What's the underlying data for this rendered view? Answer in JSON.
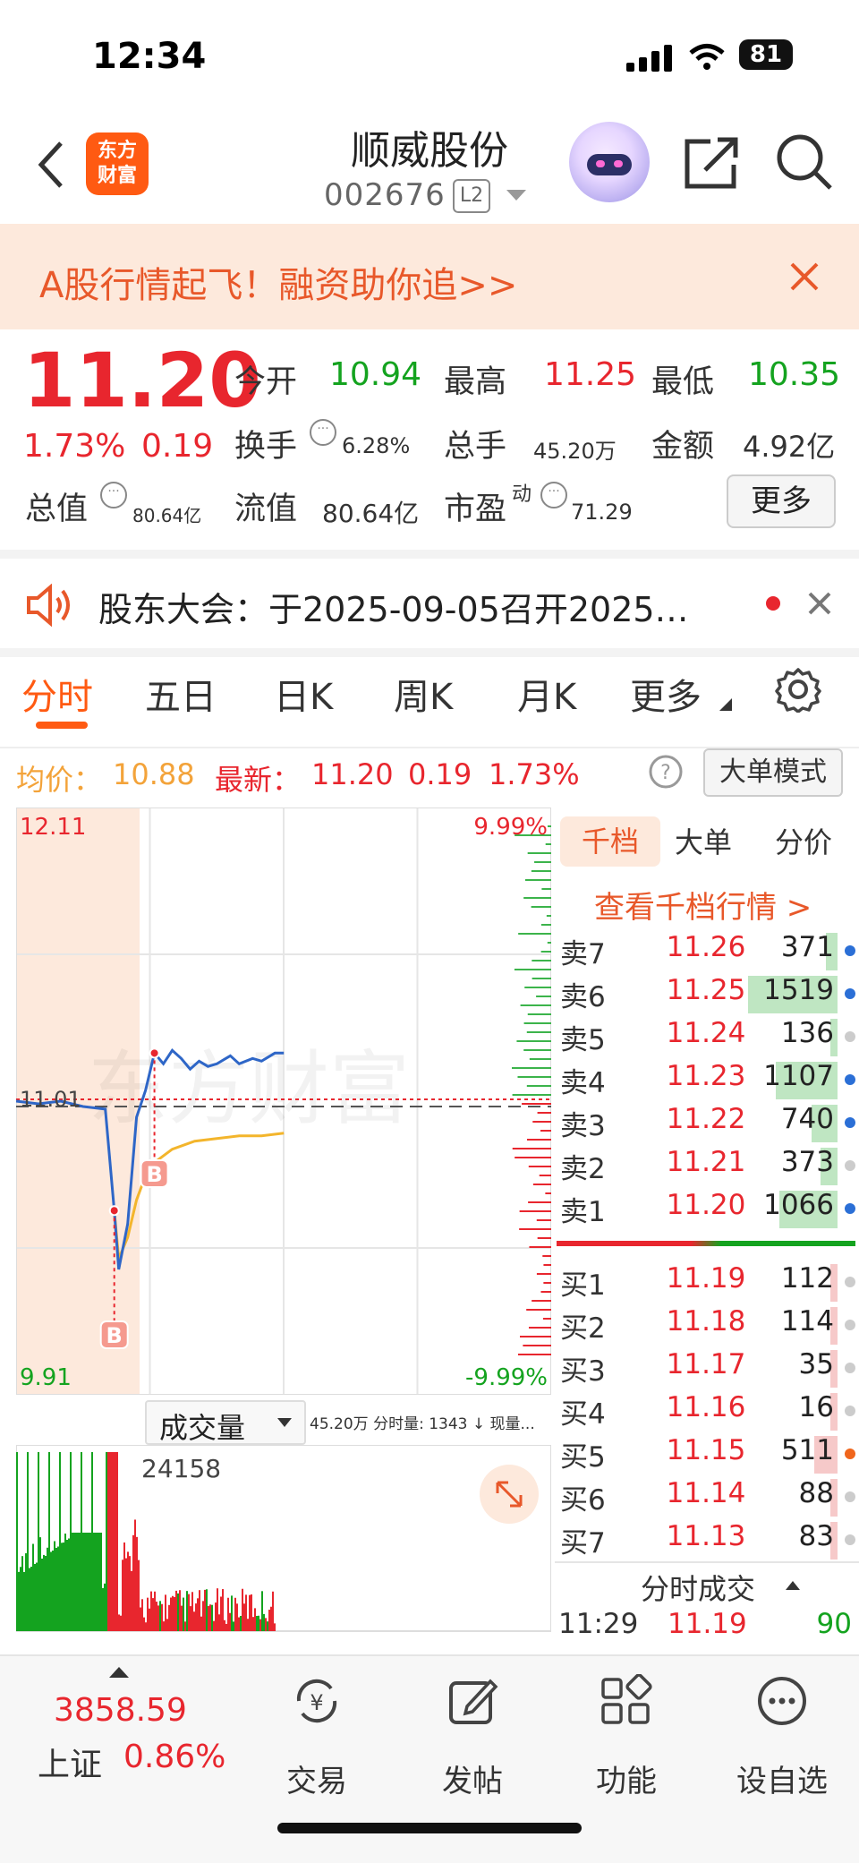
{
  "status": {
    "time": "12:34",
    "battery": "81"
  },
  "header": {
    "logo_line1": "东方",
    "logo_line2": "财富",
    "stock_name": "顺威股份",
    "stock_code": "002676",
    "level": "L2"
  },
  "banner": {
    "text": "A股行情起飞！融资助你追>>"
  },
  "quote": {
    "price": "11.20",
    "change_pct": "1.73%",
    "change": "0.19",
    "open_label": "今开",
    "open": "10.94",
    "high_label": "最高",
    "high": "11.25",
    "low_label": "最低",
    "low": "10.35",
    "turnover_label": "换手",
    "turnover": "6.28%",
    "volume_label": "总手",
    "volume": "45.20万",
    "amount_label": "金额",
    "amount": "4.92亿",
    "mcap_label": "总值",
    "mcap": "80.64亿",
    "float_label": "流值",
    "float": "80.64亿",
    "pe_label": "市盈",
    "pe_sup": "动",
    "pe": "71.29",
    "more_label": "更多"
  },
  "announcement": {
    "text": "股东大会：于2025-09-05召开2025…"
  },
  "tabs": [
    {
      "label": "分时"
    },
    {
      "label": "五日"
    },
    {
      "label": "日K"
    },
    {
      "label": "周K"
    },
    {
      "label": "月K"
    },
    {
      "label": "更多"
    }
  ],
  "info": {
    "avg_label": "均价：",
    "avg": "10.88",
    "last_label": "最新：",
    "last": "11.20",
    "last_change": "0.19",
    "last_pct": "1.73%",
    "mode_button": "大单模式"
  },
  "chart_data": {
    "type": "line",
    "y_top_label": "12.11",
    "y_bottom_label": "9.91",
    "y_mid_label": "11.01",
    "pct_top_label": "9.99%",
    "pct_bottom_label": "-9.99%",
    "ylim": [
      9.91,
      12.11
    ],
    "reference_price": 11.01,
    "series": [
      {
        "x": [
          0,
          10,
          20,
          30,
          40,
          44,
          46,
          50,
          54,
          58,
          62,
          66,
          70,
          74,
          78,
          82,
          86,
          90,
          96,
          100,
          106,
          110,
          116,
          120
        ],
        "values": [
          11.01,
          11.0,
          11.01,
          10.99,
          10.98,
          10.6,
          10.38,
          10.55,
          10.95,
          11.05,
          11.19,
          11.15,
          11.2,
          11.17,
          11.13,
          11.16,
          11.14,
          11.15,
          11.18,
          11.15,
          11.17,
          11.16,
          11.19,
          11.19
        ]
      },
      {
        "x": [
          44,
          46,
          50,
          54,
          58,
          62,
          70,
          80,
          90,
          100,
          110,
          120
        ],
        "values": [
          10.6,
          10.42,
          10.5,
          10.64,
          10.73,
          10.78,
          10.83,
          10.86,
          10.87,
          10.88,
          10.88,
          10.89
        ]
      }
    ],
    "markers": [
      "B",
      "B"
    ],
    "volume_label": "成交量",
    "volume_info": "45.20万 分时量: 1343 ↓ 现量...",
    "volume_max_label": "24158"
  },
  "orderbook": {
    "tabs": [
      {
        "label": "千档"
      },
      {
        "label": "大单"
      },
      {
        "label": "分价"
      }
    ],
    "link": "查看千档行情 >",
    "asks": [
      {
        "label": "卖7",
        "price": "11.26",
        "qty": "371",
        "bar": 0.12,
        "dot": "#2b6fd6"
      },
      {
        "label": "卖6",
        "price": "11.25",
        "qty": "1519",
        "bar": 0.95,
        "dot": "#2b6fd6"
      },
      {
        "label": "卖5",
        "price": "11.24",
        "qty": "136",
        "bar": 0.05,
        "dot": "#cccccc"
      },
      {
        "label": "卖4",
        "price": "11.23",
        "qty": "1107",
        "bar": 0.66,
        "dot": "#2b6fd6"
      },
      {
        "label": "卖3",
        "price": "11.22",
        "qty": "740",
        "bar": 0.28,
        "dot": "#2b6fd6"
      },
      {
        "label": "卖2",
        "price": "11.21",
        "qty": "373",
        "bar": 0.18,
        "dot": "#cccccc"
      },
      {
        "label": "卖1",
        "price": "11.20",
        "qty": "1066",
        "bar": 0.62,
        "dot": "#2b6fd6"
      }
    ],
    "bids": [
      {
        "label": "买1",
        "price": "11.19",
        "qty": "112",
        "bar": 0.04,
        "dot": "#cccccc"
      },
      {
        "label": "买2",
        "price": "11.18",
        "qty": "114",
        "bar": 0.04,
        "dot": "#cccccc"
      },
      {
        "label": "买3",
        "price": "11.17",
        "qty": "35",
        "bar": 0.02,
        "dot": "#cccccc"
      },
      {
        "label": "买4",
        "price": "11.16",
        "qty": "16",
        "bar": 0.01,
        "dot": "#cccccc"
      },
      {
        "label": "买5",
        "price": "11.15",
        "qty": "511",
        "bar": 0.25,
        "dot": "#f0661c"
      },
      {
        "label": "买6",
        "price": "11.14",
        "qty": "88",
        "bar": 0.03,
        "dot": "#cccccc"
      },
      {
        "label": "买7",
        "price": "11.13",
        "qty": "83",
        "bar": 0.03,
        "dot": "#cccccc"
      }
    ],
    "trades_header": "分时成交",
    "trade": {
      "time": "11:29",
      "price": "11.19",
      "qty": "90"
    }
  },
  "bottom": {
    "index_value": "3858.59",
    "index_name": "上证",
    "index_pct": "0.86%",
    "items": [
      {
        "label": "交易"
      },
      {
        "label": "发帖"
      },
      {
        "label": "功能"
      },
      {
        "label": "设自选"
      }
    ]
  }
}
